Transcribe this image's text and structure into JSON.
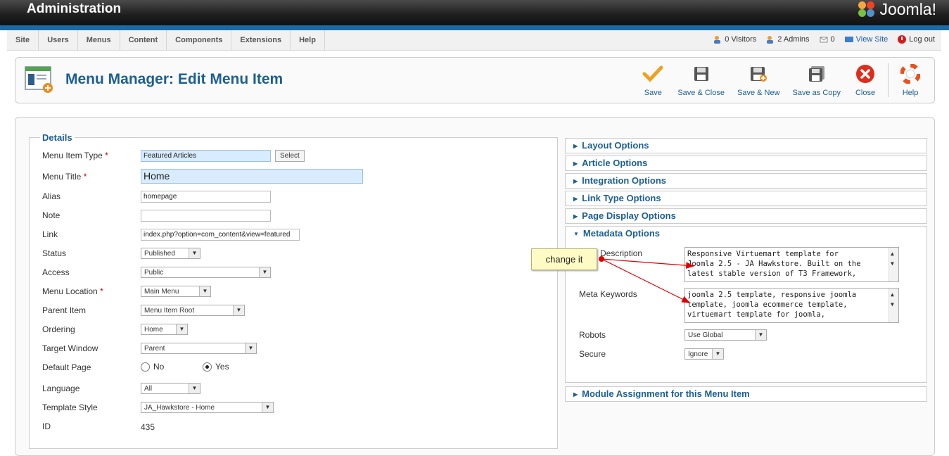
{
  "app": {
    "title": "Administration",
    "logo_text": "Joomla!"
  },
  "menubar": [
    "Site",
    "Users",
    "Menus",
    "Content",
    "Components",
    "Extensions",
    "Help"
  ],
  "status": {
    "visitors": "0 Visitors",
    "admins": "2 Admins",
    "messages": "0",
    "view_site": "View Site",
    "logout": "Log out"
  },
  "page": {
    "title": "Menu Manager: Edit Menu Item"
  },
  "toolbar": {
    "save": "Save",
    "save_close": "Save & Close",
    "save_new": "Save & New",
    "save_copy": "Save as Copy",
    "close": "Close",
    "help": "Help"
  },
  "details": {
    "legend": "Details",
    "menu_item_type": {
      "label": "Menu Item Type",
      "value": "Featured Articles",
      "button": "Select"
    },
    "menu_title": {
      "label": "Menu Title",
      "value": "Home"
    },
    "alias": {
      "label": "Alias",
      "value": "homepage"
    },
    "note": {
      "label": "Note",
      "value": ""
    },
    "link": {
      "label": "Link",
      "value": "index.php?option=com_content&view=featured"
    },
    "status": {
      "label": "Status",
      "value": "Published"
    },
    "access": {
      "label": "Access",
      "value": "Public"
    },
    "menu_location": {
      "label": "Menu Location",
      "value": "Main Menu"
    },
    "parent_item": {
      "label": "Parent Item",
      "value": "Menu Item Root"
    },
    "ordering": {
      "label": "Ordering",
      "value": "Home"
    },
    "target_window": {
      "label": "Target Window",
      "value": "Parent"
    },
    "default_page": {
      "label": "Default Page",
      "no": "No",
      "yes": "Yes",
      "selected": "Yes"
    },
    "language": {
      "label": "Language",
      "value": "All"
    },
    "template_style": {
      "label": "Template Style",
      "value": "JA_Hawkstore - Home"
    },
    "id": {
      "label": "ID",
      "value": "435"
    }
  },
  "panels": [
    "Layout Options",
    "Article Options",
    "Integration Options",
    "Link Type Options",
    "Page Display Options",
    "Metadata Options",
    "Module Assignment for this Menu Item"
  ],
  "metadata": {
    "description_label": "Description",
    "description_value": "Responsive Virtuemart template for\nJoomla 2.5 - JA Hawkstore. Built on the\nlatest stable version of T3 Framework,",
    "keywords_label": "Meta Keywords",
    "keywords_value": "joomla 2.5 template, responsive joomla\ntemplate, joomla ecommerce template,\nvirtuemart template for joomla,",
    "robots_label": "Robots",
    "robots_value": "Use Global",
    "secure_label": "Secure",
    "secure_value": "Ignore"
  },
  "annotation": {
    "text": "change it",
    "color": "#e00000"
  }
}
